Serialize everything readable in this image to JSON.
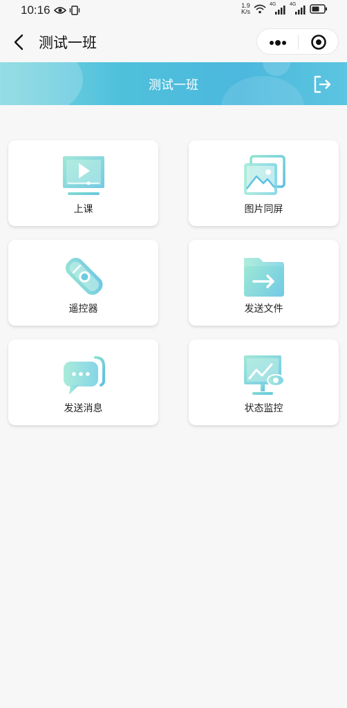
{
  "status_bar": {
    "time": "10:16",
    "speed_value": "1.9",
    "speed_unit": "K/s",
    "network1": "4G",
    "network2": "4G"
  },
  "nav": {
    "title": "测试一班"
  },
  "banner": {
    "title": "测试一班"
  },
  "colors": {
    "accent": "#4cb8dd",
    "icon_teal": "#7fdcd2",
    "icon_blue": "#5cbfe2",
    "background": "#f7f7f7"
  },
  "cards": [
    {
      "label": "上课",
      "icon": "video-play-icon"
    },
    {
      "label": "图片同屏",
      "icon": "image-gallery-icon"
    },
    {
      "label": "遥控器",
      "icon": "remote-control-icon"
    },
    {
      "label": "发送文件",
      "icon": "folder-send-icon"
    },
    {
      "label": "发送消息",
      "icon": "chat-message-icon"
    },
    {
      "label": "状态监控",
      "icon": "monitor-eye-icon"
    }
  ]
}
